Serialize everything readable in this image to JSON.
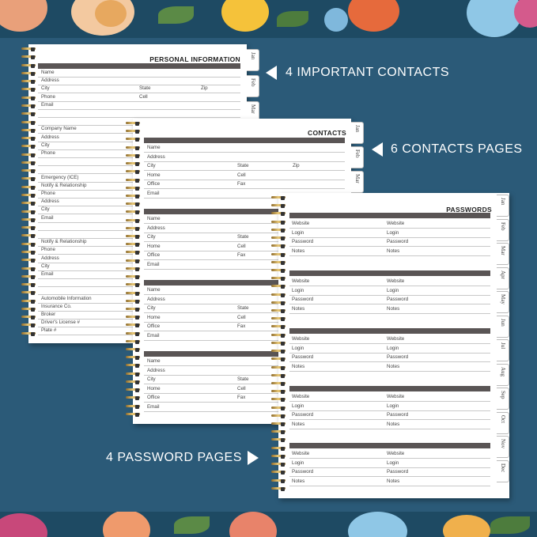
{
  "callouts": {
    "important_contacts": "4 IMPORTANT CONTACTS",
    "contacts_pages": "6 CONTACTS PAGES",
    "password_pages": "4 PASSWORD PAGES"
  },
  "personal_page": {
    "title": "PERSONAL INFORMATION",
    "tabs": [
      "Jan",
      "Feb",
      "Mar"
    ],
    "block1": [
      "Name",
      "Address",
      "City",
      "Phone",
      "Email"
    ],
    "block1_right": [
      "State",
      "Cell"
    ],
    "block1_zip": "Zip",
    "block2": [
      "Company Name",
      "Address",
      "City",
      "Phone"
    ],
    "block3": [
      "Emergency (ICE)",
      "Notify & Relationship",
      "Phone",
      "Address",
      "City",
      "Email"
    ],
    "block4": [
      "Notify & Relationship",
      "Phone",
      "Address",
      "City",
      "Email"
    ],
    "block5": [
      "Automobile Information",
      "Insurance Co.",
      "Broker",
      "Driver's License #",
      "Plate #"
    ]
  },
  "contacts_page": {
    "title": "CONTACTS",
    "tabs": [
      "Jan",
      "Feb",
      "Mar"
    ],
    "fields_left": [
      "Name",
      "Address",
      "City",
      "Home",
      "Office",
      "Email"
    ],
    "fields_right": [
      "State",
      "Cell",
      "Fax"
    ],
    "zip": "Zip"
  },
  "passwords_page": {
    "title": "PASSWORDS",
    "tabs": [
      "Jan",
      "Feb",
      "Mar",
      "Apr",
      "May",
      "Jun",
      "Jul",
      "Aug",
      "Sep",
      "Oct",
      "Nov",
      "Dec"
    ],
    "fields_left": [
      "Website",
      "Login",
      "Password",
      "Notes"
    ],
    "fields_right": [
      "Website",
      "Login",
      "Password",
      "Notes"
    ]
  }
}
